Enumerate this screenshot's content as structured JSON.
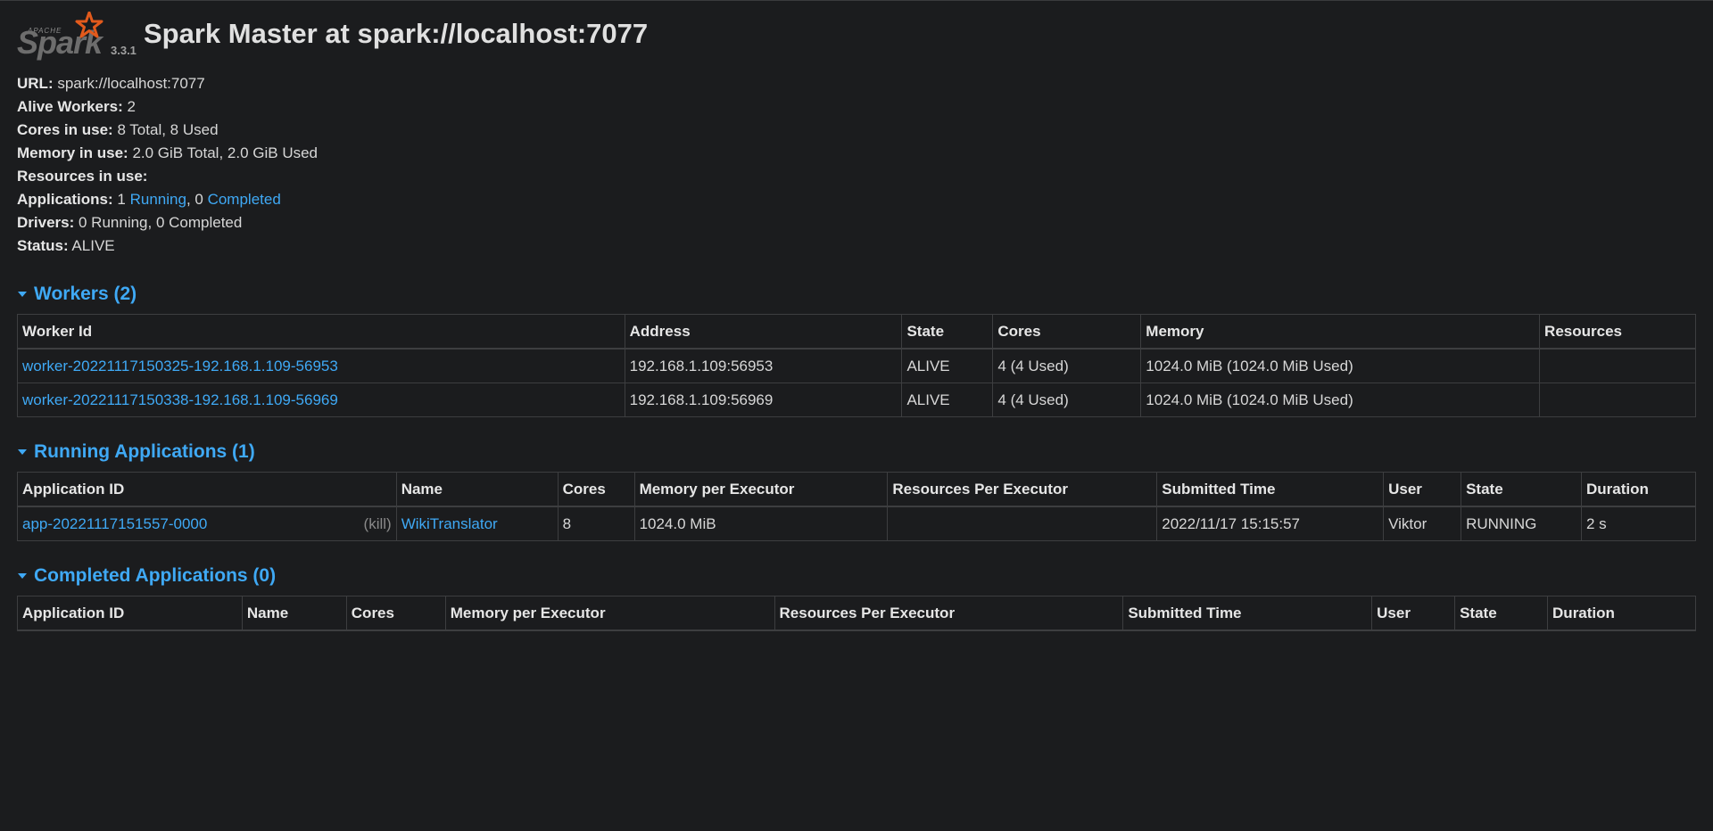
{
  "header": {
    "logo_apache": "APACHE",
    "logo_word": "Spark",
    "version": "3.3.1",
    "title": "Spark Master at spark://localhost:7077"
  },
  "summary": {
    "url_label": "URL:",
    "url_value": "spark://localhost:7077",
    "alive_workers_label": "Alive Workers:",
    "alive_workers_value": "2",
    "cores_label": "Cores in use:",
    "cores_value": "8 Total, 8 Used",
    "memory_label": "Memory in use:",
    "memory_value": "2.0 GiB Total, 2.0 GiB Used",
    "resources_label": "Resources in use:",
    "applications_label": "Applications:",
    "applications_running_count": "1",
    "applications_running_link": "Running",
    "applications_sep": ", 0",
    "applications_completed_link": "Completed",
    "drivers_label": "Drivers:",
    "drivers_value": "0 Running, 0 Completed",
    "status_label": "Status:",
    "status_value": "ALIVE"
  },
  "workers": {
    "title": "Workers (2)",
    "columns": [
      "Worker Id",
      "Address",
      "State",
      "Cores",
      "Memory",
      "Resources"
    ],
    "rows": [
      {
        "id": "worker-20221117150325-192.168.1.109-56953",
        "address": "192.168.1.109:56953",
        "state": "ALIVE",
        "cores": "4 (4 Used)",
        "memory": "1024.0 MiB (1024.0 MiB Used)",
        "resources": ""
      },
      {
        "id": "worker-20221117150338-192.168.1.109-56969",
        "address": "192.168.1.109:56969",
        "state": "ALIVE",
        "cores": "4 (4 Used)",
        "memory": "1024.0 MiB (1024.0 MiB Used)",
        "resources": ""
      }
    ]
  },
  "running_apps": {
    "title": "Running Applications (1)",
    "columns": [
      "Application ID",
      "Name",
      "Cores",
      "Memory per Executor",
      "Resources Per Executor",
      "Submitted Time",
      "User",
      "State",
      "Duration"
    ],
    "rows": [
      {
        "id": "app-20221117151557-0000",
        "kill": "(kill)",
        "name": "WikiTranslator",
        "cores": "8",
        "memory": "1024.0 MiB",
        "resources": "",
        "submitted": "2022/11/17 15:15:57",
        "user": "Viktor",
        "state": "RUNNING",
        "duration": "2 s"
      }
    ]
  },
  "completed_apps": {
    "title": "Completed Applications (0)",
    "columns": [
      "Application ID",
      "Name",
      "Cores",
      "Memory per Executor",
      "Resources Per Executor",
      "Submitted Time",
      "User",
      "State",
      "Duration"
    ]
  },
  "colors": {
    "background": "#1b1c1e",
    "link": "#3fa9f5",
    "logo_star": "#e25a1c"
  }
}
